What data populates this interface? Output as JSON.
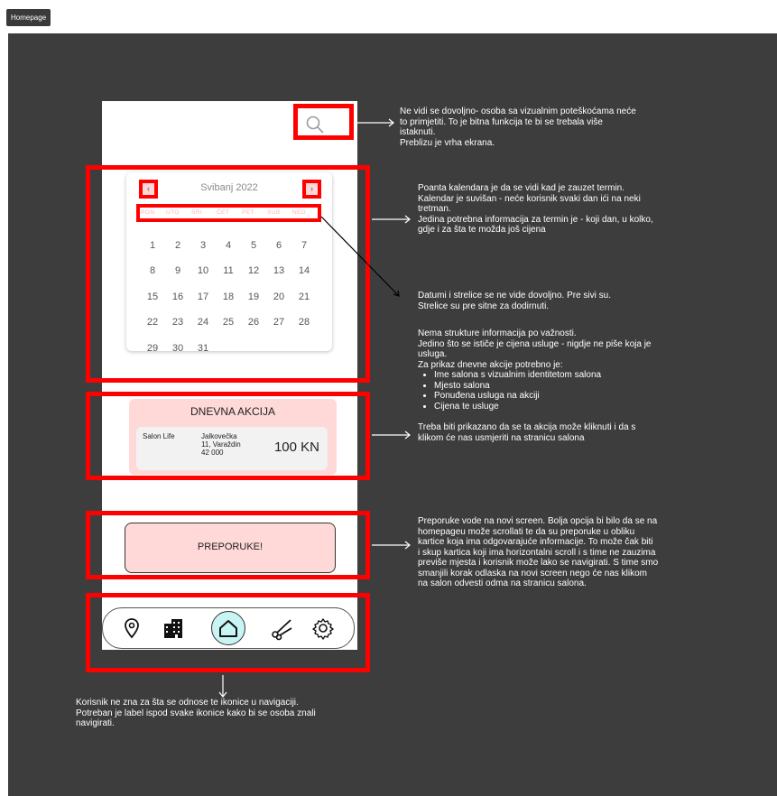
{
  "tab": {
    "label": "Homepage"
  },
  "calendar": {
    "month": "Svibanj 2022",
    "prev_icon": "chevron-left-icon",
    "next_icon": "chevron-right-icon",
    "weekdays": [
      "PON",
      "UTO",
      "SRI",
      "ČET",
      "PET",
      "SUB",
      "NED"
    ],
    "weeks": [
      [
        "1",
        "2",
        "3",
        "4",
        "5",
        "6",
        "7"
      ],
      [
        "8",
        "9",
        "10",
        "11",
        "12",
        "13",
        "14"
      ],
      [
        "15",
        "16",
        "17",
        "18",
        "19",
        "20",
        "21"
      ],
      [
        "22",
        "23",
        "24",
        "25",
        "26",
        "27",
        "28"
      ],
      [
        "29",
        "30",
        "31"
      ]
    ]
  },
  "promo": {
    "title": "DNEVNA AKCIJA",
    "salon": "Salon Life",
    "address_line1": "Jalkovečka",
    "address_line2": "11, Varaždin",
    "address_line3": "42 000",
    "price": "100 KN"
  },
  "recommendations": {
    "label": "PREPORUKE!"
  },
  "navbar": {
    "icons": [
      "map-pin-icon",
      "building-icon",
      "home-icon",
      "scissors-icon",
      "gear-icon"
    ]
  },
  "notes": {
    "search": [
      "Ne vidi se dovoljno- osoba sa vizualnim poteškoćama neće",
      "to primjetiti. To je bitna funkcija te bi se trebala više",
      "istaknuti.",
      "Preblizu je vrha ekrana."
    ],
    "calendar": [
      "Poanta kalendara je da se vidi kad je zauzet termin.",
      "Kalendar je suvišan - neće korisnik svaki dan ići na neki",
      "tretman.",
      "Jedina potrebna informacija za termin je - koji dan, u kolko,",
      "gdje i za šta te možda još cijena"
    ],
    "dates": [
      "Datumi i strelice se ne vide dovoljno. Pre sivi su.",
      "Strelice su pre sitne za dodirnuti."
    ],
    "promo_intro": [
      "Nema strukture informacija po važnosti.",
      "Jedino što se ističe je cijena usluge - nigdje ne piše koja je",
      "usluga.",
      "Za prikaz dnevne akcije potrebno je:"
    ],
    "promo_list": [
      "Ime salona s vizualnim identitetom salona",
      "Mjesto salona",
      "Ponuđena usluga na akciji",
      "Cijena te usluge"
    ],
    "promo_outro": [
      "Treba biti prikazano da se ta akcija može kliknuti i da s",
      "klikom će nas usmjeriti na stranicu salona"
    ],
    "recommend": [
      "Preporuke vode na novi screen. Bolja opcija bi bilo da se na",
      "homepageu može scrollati te da su preporuke u obliku",
      "kartice koja ima odgovarajuće informacije. To može čak biti",
      "i skup kartica koji ima horizontalni scroll i s time ne zauzima",
      "previše mjesta i korisnik može lako se navigirati. S time smo",
      "smanjili korak odlaska na novi screen nego će nas klikom",
      "na salon odvesti odma na stranicu salona."
    ],
    "navbar": [
      "Korisnik ne zna za šta se odnose te ikonice u navigaciji.",
      "Potreban je label ispod svake ikonice kako bi se osoba znali",
      "navigirati."
    ]
  },
  "colors": {
    "highlight": "#ff0000",
    "canvas": "#3d3d3d",
    "promo_bg": "#ffd8d8",
    "home_active": "#c9f4f4"
  }
}
